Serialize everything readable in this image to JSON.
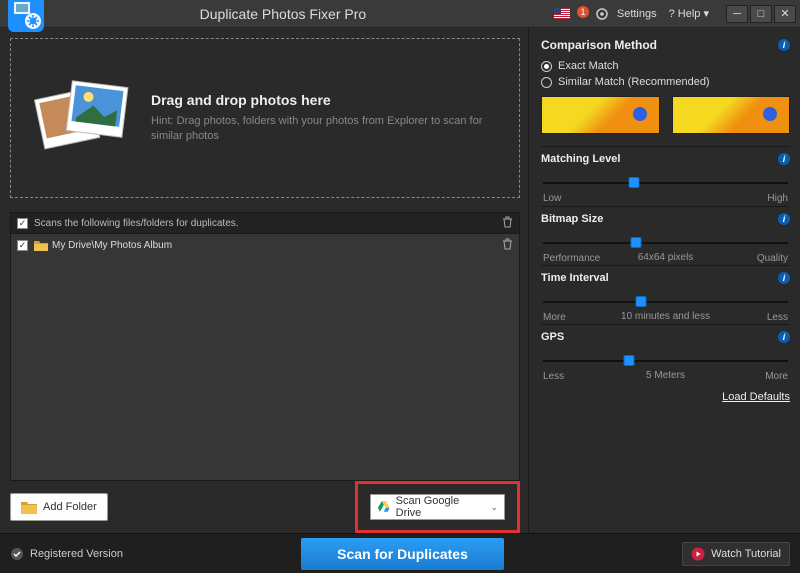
{
  "titlebar": {
    "app_title": "Duplicate Photos Fixer Pro",
    "settings_label": "Settings",
    "help_label": "? Help",
    "help_caret": "▾"
  },
  "dropzone": {
    "heading": "Drag and drop photos here",
    "hint": "Hint: Drag photos, folders with your photos from Explorer to scan for similar photos"
  },
  "list": {
    "header_label": "Scans the following files/folders for duplicates.",
    "rows": [
      {
        "label": "My Drive\\My Photos Album",
        "checked": true
      }
    ]
  },
  "buttons": {
    "add_folder": "Add Folder",
    "scan_gdrive": "Scan Google Drive",
    "scan_duplicates": "Scan for Duplicates",
    "watch_tutorial": "Watch Tutorial"
  },
  "footer": {
    "registered_label": "Registered Version"
  },
  "right": {
    "comparison_method": "Comparison Method",
    "exact_match": "Exact Match",
    "similar_match": "Similar Match (Recommended)",
    "matching_level": {
      "title": "Matching Level",
      "left": "Low",
      "right": "High",
      "pos": 37
    },
    "bitmap_size": {
      "title": "Bitmap Size",
      "left": "Performance",
      "right": "Quality",
      "center": "64x64 pixels",
      "pos": 38
    },
    "time_interval": {
      "title": "Time Interval",
      "left": "More",
      "right": "Less",
      "center": "10 minutes and less",
      "pos": 40
    },
    "gps": {
      "title": "GPS",
      "left": "Less",
      "right": "More",
      "center": "5 Meters",
      "pos": 35
    },
    "load_defaults": "Load Defaults"
  }
}
